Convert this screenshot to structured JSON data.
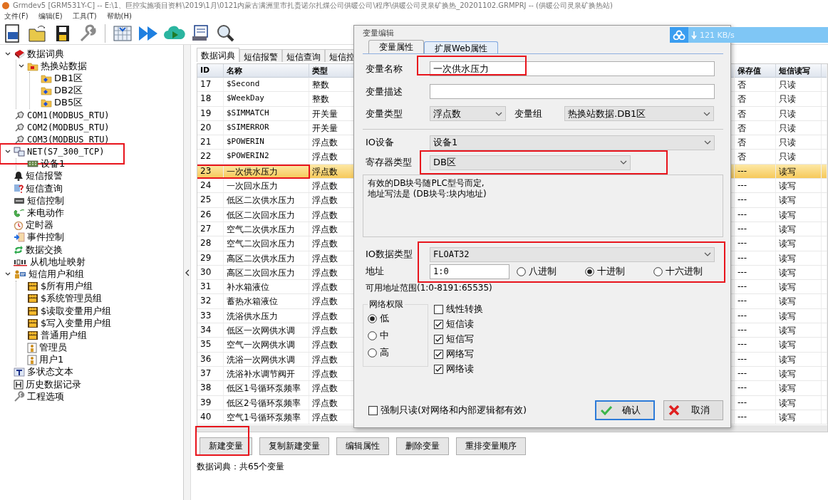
{
  "window": {
    "title": "Grmdev5 [GRM531Y-C]  -- E:\\1、巨控实施项目资料\\2019\\1月\\0121内蒙古满洲里市扎赉诺尔扎煤公司供暖公司\\程序\\供暖公司灵泉矿换热_20201102.GRMPRJ -- (供暖公司灵泉矿换热站)"
  },
  "menu": [
    "文件(F)",
    "编辑(E)",
    "工具(T)",
    "帮助(H)"
  ],
  "tree": [
    {
      "label": "数据词典",
      "kind": "book",
      "expanded": true,
      "children": [
        {
          "label": "热换站数据",
          "kind": "folder",
          "expanded": true,
          "children": [
            {
              "label": "DB1区",
              "kind": "subfolder"
            },
            {
              "label": "DB2区",
              "kind": "subfolder"
            },
            {
              "label": "DB5区",
              "kind": "subfolder"
            }
          ]
        }
      ]
    },
    {
      "label": "COM1(MODBUS_RTU)",
      "kind": "port"
    },
    {
      "label": "COM2(MODBUS_RTU)",
      "kind": "port"
    },
    {
      "label": "COM3(MODBUS_RTU)",
      "kind": "port"
    },
    {
      "label": "NET(S7_300_TCP)",
      "kind": "network",
      "expanded": true,
      "highlighted": true,
      "children": [
        {
          "label": "设备1",
          "kind": "device"
        }
      ]
    },
    {
      "label": "短信报警",
      "kind": "alarm"
    },
    {
      "label": "短信查询",
      "kind": "query"
    },
    {
      "label": "短信控制",
      "kind": "command"
    },
    {
      "label": "来电动作",
      "kind": "phone"
    },
    {
      "label": "定时器",
      "kind": "timer"
    },
    {
      "label": "事件控制",
      "kind": "event"
    },
    {
      "label": "数据交换",
      "kind": "exchange"
    },
    {
      "label": "从机地址映射",
      "kind": "mapping"
    },
    {
      "label": "短信用户和组",
      "kind": "users",
      "expanded": true,
      "children": [
        {
          "label": "$所有用户组",
          "kind": "group"
        },
        {
          "label": "$系统管理员组",
          "kind": "group"
        },
        {
          "label": "$读取变量用户组",
          "kind": "group"
        },
        {
          "label": "$写入变量用户组",
          "kind": "group"
        },
        {
          "label": "普通用户组",
          "kind": "group"
        },
        {
          "label": "管理员",
          "kind": "user"
        },
        {
          "label": "用户1",
          "kind": "user"
        }
      ]
    },
    {
      "label": "多状态文本",
      "kind": "text"
    },
    {
      "label": "历史数据记录",
      "kind": "history"
    },
    {
      "label": "工程选项",
      "kind": "options"
    }
  ],
  "tabs": [
    {
      "label": "数据词典",
      "selected": true
    },
    {
      "label": "短信报警",
      "selected": false
    },
    {
      "label": "短信查询",
      "selected": false
    },
    {
      "label": "短信控",
      "selected": false
    }
  ],
  "table": {
    "columns": [
      "ID",
      "名称",
      "类型",
      "保存值",
      "短信读写"
    ],
    "rows": [
      {
        "cells": [
          "17",
          "$Second",
          "整数",
          "否",
          "只读"
        ],
        "selected": false,
        "highlighted": false
      },
      {
        "cells": [
          "18",
          "$WeekDay",
          "整数",
          "否",
          "只读"
        ],
        "selected": false,
        "highlighted": false
      },
      {
        "cells": [
          "19",
          "$SIMMATCH",
          "开关量",
          "否",
          "只读"
        ],
        "selected": false,
        "highlighted": false
      },
      {
        "cells": [
          "20",
          "$SIMERROR",
          "开关量",
          "否",
          "只读"
        ],
        "selected": false,
        "highlighted": false
      },
      {
        "cells": [
          "21",
          "$POWERIN",
          "浮点数",
          "否",
          "只读"
        ],
        "selected": false,
        "highlighted": false
      },
      {
        "cells": [
          "22",
          "$POWERIN2",
          "浮点数",
          "否",
          "只读"
        ],
        "selected": false,
        "highlighted": false
      },
      {
        "cells": [
          "23",
          "一次供水压力",
          "浮点数",
          "---",
          "读写"
        ],
        "selected": true,
        "highlighted": true
      },
      {
        "cells": [
          "24",
          "一次回水压力",
          "浮点数",
          "---",
          "读写"
        ],
        "selected": false,
        "highlighted": false
      },
      {
        "cells": [
          "25",
          "低区二次供水压力",
          "浮点数",
          "---",
          "读写"
        ],
        "selected": false,
        "highlighted": false
      },
      {
        "cells": [
          "26",
          "低区二次回水压力",
          "浮点数",
          "---",
          "读写"
        ],
        "selected": false,
        "highlighted": false
      },
      {
        "cells": [
          "27",
          "空气二次供水压力",
          "浮点数",
          "---",
          "读写"
        ],
        "selected": false,
        "highlighted": false
      },
      {
        "cells": [
          "28",
          "空气二次回水压力",
          "浮点数",
          "---",
          "读写"
        ],
        "selected": false,
        "highlighted": false
      },
      {
        "cells": [
          "29",
          "高区二次供水压力",
          "浮点数",
          "---",
          "读写"
        ],
        "selected": false,
        "highlighted": false
      },
      {
        "cells": [
          "30",
          "高区二次回水压力",
          "浮点数",
          "---",
          "读写"
        ],
        "selected": false,
        "highlighted": false
      },
      {
        "cells": [
          "31",
          "补水箱液位",
          "浮点数",
          "---",
          "读写"
        ],
        "selected": false,
        "highlighted": false
      },
      {
        "cells": [
          "32",
          "蓄热水箱液位",
          "浮点数",
          "---",
          "读写"
        ],
        "selected": false,
        "highlighted": false
      },
      {
        "cells": [
          "33",
          "洗浴供水压力",
          "浮点数",
          "---",
          "读写"
        ],
        "selected": false,
        "highlighted": false
      },
      {
        "cells": [
          "34",
          "低区一次网供水调",
          "浮点数",
          "---",
          "读写"
        ],
        "selected": false,
        "highlighted": false
      },
      {
        "cells": [
          "35",
          "空气一次网供水调",
          "浮点数",
          "---",
          "读写"
        ],
        "selected": false,
        "highlighted": false
      },
      {
        "cells": [
          "36",
          "洗浴一次网供水调",
          "浮点数",
          "---",
          "读写"
        ],
        "selected": false,
        "highlighted": false
      },
      {
        "cells": [
          "37",
          "洗浴补水调节阀开",
          "浮点数",
          "---",
          "读写"
        ],
        "selected": false,
        "highlighted": false
      },
      {
        "cells": [
          "38",
          "低区1号循环泵频率",
          "浮点数",
          "---",
          "读写"
        ],
        "selected": false,
        "highlighted": false
      },
      {
        "cells": [
          "39",
          "低区2号循环泵频率",
          "浮点数",
          "---",
          "读写"
        ],
        "selected": false,
        "highlighted": false
      },
      {
        "cells": [
          "40",
          "空气1号循环泵频率",
          "浮点数",
          "---",
          "读写"
        ],
        "selected": false,
        "highlighted": false
      }
    ]
  },
  "buttons": [
    {
      "label": "新建变量",
      "highlighted": true
    },
    {
      "label": "复制新建变量",
      "highlighted": false
    },
    {
      "label": "编辑属性",
      "highlighted": false
    },
    {
      "label": "删除变量",
      "highlighted": false
    },
    {
      "label": "重排变量顺序",
      "highlighted": false
    }
  ],
  "status_bar": "数据词典：共65个变量",
  "speed_badge": "121 KB/s",
  "dialog": {
    "title": "变量编辑",
    "tabs": [
      {
        "label": "变量属性",
        "selected": true
      },
      {
        "label": "扩展Web属性",
        "selected": false
      }
    ],
    "name": {
      "label": "变量名称",
      "value": "一次供水压力",
      "highlighted": true
    },
    "description": {
      "label": "变量描述"
    },
    "var_type": {
      "label": "变量类型",
      "value": "浮点数"
    },
    "var_group": {
      "label": "变量组",
      "value": "热换站数据.DB1区"
    },
    "io_device": {
      "label": "IO设备",
      "value": "设备1"
    },
    "register_type": {
      "label": "寄存器类型",
      "value": "DB区",
      "highlighted": true
    },
    "note": "有效的DB块号随PLC型号而定,\n地址写法是 (DB块号:块内地址)",
    "io_block": {
      "highlighted": true,
      "data_type": {
        "label": "IO数据类型",
        "value": "FLOAT32"
      },
      "address": {
        "label": "地址",
        "value": "1:0"
      },
      "radix": [
        {
          "label": "八进制",
          "selected": false
        },
        {
          "label": "十进制",
          "selected": true
        },
        {
          "label": "十六进制",
          "selected": false
        }
      ]
    },
    "range_hint": "可用地址范围(1:0-8191:65535)",
    "permission": {
      "title": "网络权限",
      "options": [
        {
          "label": "低",
          "selected": true
        },
        {
          "label": "中",
          "selected": false
        },
        {
          "label": "高",
          "selected": false
        }
      ]
    },
    "options": [
      {
        "label": "线性转换",
        "checked": false
      },
      {
        "label": "短信读",
        "checked": true
      },
      {
        "label": "短信写",
        "checked": true
      },
      {
        "label": "网络写",
        "checked": true
      },
      {
        "label": "网络读",
        "checked": true
      }
    ],
    "force_readonly": {
      "label": "强制只读(对网络和内部逻辑都有效)",
      "checked": false
    },
    "buttons": [
      {
        "label": "确认",
        "kind": "ok"
      },
      {
        "label": "取消",
        "kind": "cancel"
      }
    ]
  }
}
